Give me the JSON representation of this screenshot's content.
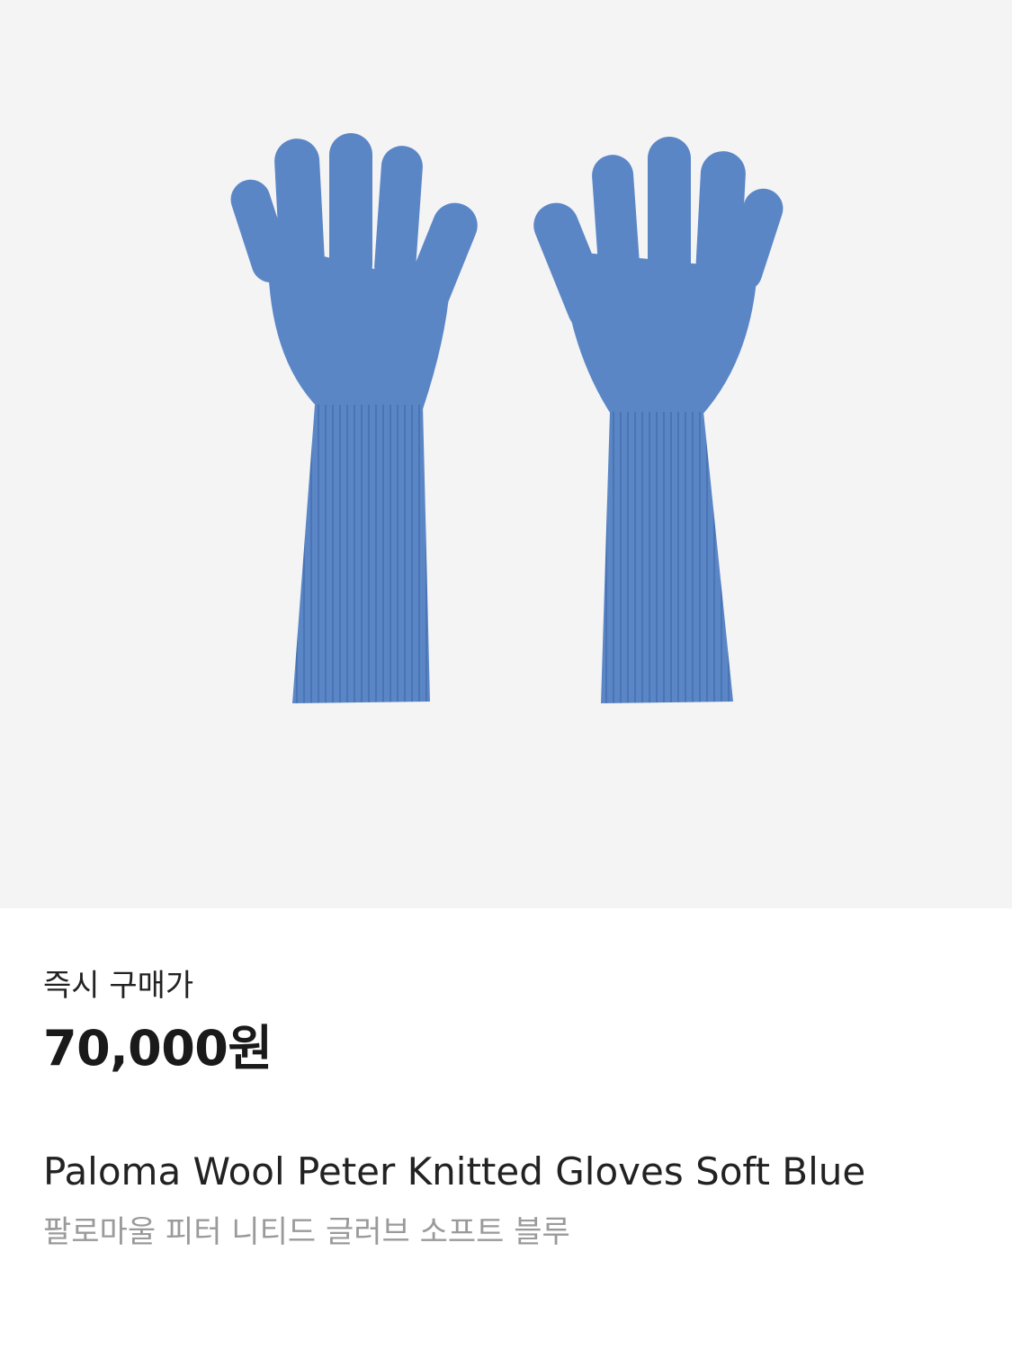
{
  "product": {
    "image_icon": "knitted-gloves-image",
    "glove_color": "#5b86c6",
    "glove_color_dark": "#4a74b5",
    "background_color": "#f4f4f5"
  },
  "pricing": {
    "label": "즉시 구매가",
    "price": "70,000원"
  },
  "title": {
    "english": "Paloma Wool Peter Knitted Gloves Soft Blue",
    "korean": "팔로마울 피터 니티드 글러브 소프트 블루"
  }
}
